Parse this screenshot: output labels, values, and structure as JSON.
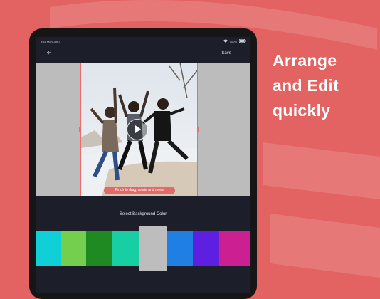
{
  "promo": {
    "line1": "Arrange",
    "line2": "and Edit",
    "line3": "quickly"
  },
  "status": {
    "time": "9:41  Mon Jun 3",
    "battery": "100%"
  },
  "editor": {
    "back_icon": "back-arrow-icon",
    "save_label": "Save",
    "hint": "Pinch to drag, rotate and move",
    "section_title": "Select Background Color"
  },
  "colors": [
    {
      "hex": "#0fd0d6"
    },
    {
      "hex": "#74cf4e"
    },
    {
      "hex": "#1f8a22"
    },
    {
      "hex": "#18cfa3"
    },
    {
      "hex": "#bdbdbd"
    },
    {
      "hex": "#1f7fe3"
    },
    {
      "hex": "#5d1fe0"
    },
    {
      "hex": "#cc2092"
    }
  ],
  "selected_color_index": 4,
  "theme": {
    "background": "#e36262",
    "accent": "#ef6a6a"
  }
}
